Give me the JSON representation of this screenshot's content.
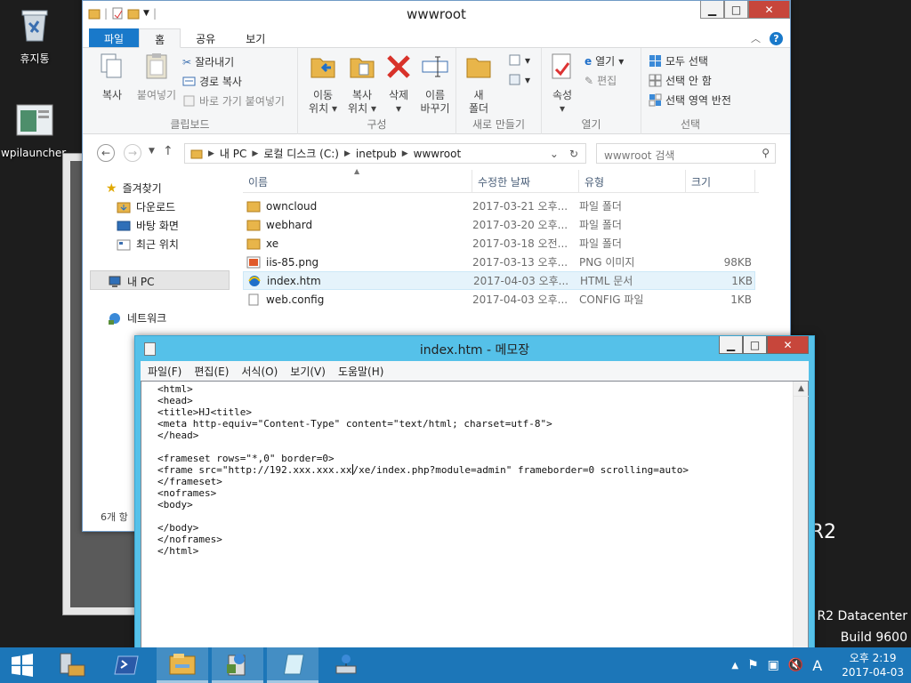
{
  "desktop": {
    "icons": [
      {
        "label": "휴지통"
      },
      {
        "label": "wpilauncher."
      }
    ],
    "watermark": {
      "r2": "R2",
      "edition": "R2 Datacenter",
      "build": "Build 9600"
    }
  },
  "explorer": {
    "title": "wwwroot",
    "tabs": [
      "파일",
      "홈",
      "공유",
      "보기"
    ],
    "ribbon": {
      "clipboard": {
        "copy": "복사",
        "paste": "붙여넣기",
        "cut": "잘라내기",
        "copy_path": "경로 복사",
        "paste_shortcut": "바로 가기 붙여넣기",
        "label": "클립보드"
      },
      "organize": {
        "move_l1": "이동",
        "move_l2": "위치",
        "copy_l1": "복사",
        "copy_l2": "위치",
        "delete": "삭제",
        "rename_l1": "이름",
        "rename_l2": "바꾸기",
        "label": "구성"
      },
      "new": {
        "folder_l1": "새",
        "folder_l2": "폴더",
        "label": "새로 만들기"
      },
      "open": {
        "properties": "속성",
        "open": "열기",
        "edit": "편집",
        "label": "열기"
      },
      "select": {
        "all": "모두 선택",
        "none": "선택 안 함",
        "invert": "선택 영역 반전",
        "label": "선택"
      }
    },
    "address": {
      "parts": [
        "내 PC",
        "로컬 디스크 (C:)",
        "inetpub",
        "wwwroot"
      ]
    },
    "search": {
      "placeholder": "wwwroot 검색"
    },
    "nav": {
      "favorites": "즐겨찾기",
      "downloads": "다운로드",
      "desktop": "바탕 화면",
      "recent": "최근 위치",
      "this_pc": "내 PC",
      "network": "네트워크"
    },
    "status": "6개 항",
    "columns": [
      "이름",
      "수정한 날짜",
      "유형",
      "크기"
    ],
    "files": [
      {
        "name": "owncloud",
        "date": "2017-03-21 오후...",
        "type": "파일 폴더",
        "size": "",
        "icon": "folder-icon"
      },
      {
        "name": "webhard",
        "date": "2017-03-20 오후...",
        "type": "파일 폴더",
        "size": "",
        "icon": "folder-icon"
      },
      {
        "name": "xe",
        "date": "2017-03-18 오전...",
        "type": "파일 폴더",
        "size": "",
        "icon": "folder-icon"
      },
      {
        "name": "iis-85.png",
        "date": "2017-03-13 오후...",
        "type": "PNG 이미지",
        "size": "98KB",
        "icon": "image-icon"
      },
      {
        "name": "index.htm",
        "date": "2017-04-03 오후...",
        "type": "HTML 문서",
        "size": "1KB",
        "icon": "ie-icon"
      },
      {
        "name": "web.config",
        "date": "2017-04-03 오후...",
        "type": "CONFIG 파일",
        "size": "1KB",
        "icon": "file-icon"
      }
    ]
  },
  "notepad": {
    "title": "index.htm - 메모장",
    "menu": [
      "파일(F)",
      "편집(E)",
      "서식(O)",
      "보기(V)",
      "도움말(H)"
    ],
    "content_before_caret": "<html>\n<head>\n<title>HJ<title>\n<meta http-equiv=\"Content-Type\" content=\"text/html; charset=utf-8\">\n</head>\n\n<frameset rows=\"*,0\" border=0>\n<frame src=\"http://192.xxx.xxx.xx",
    "content_after_caret": "/xe/index.php?module=admin\" frameborder=0 scrolling=auto>\n</frameset>\n<noframes>\n<body>\n\n</body>\n</noframes>\n</html>"
  },
  "taskbar": {
    "clock_time": "오후 2:19",
    "clock_date": "2017-04-03",
    "ime": "A"
  }
}
